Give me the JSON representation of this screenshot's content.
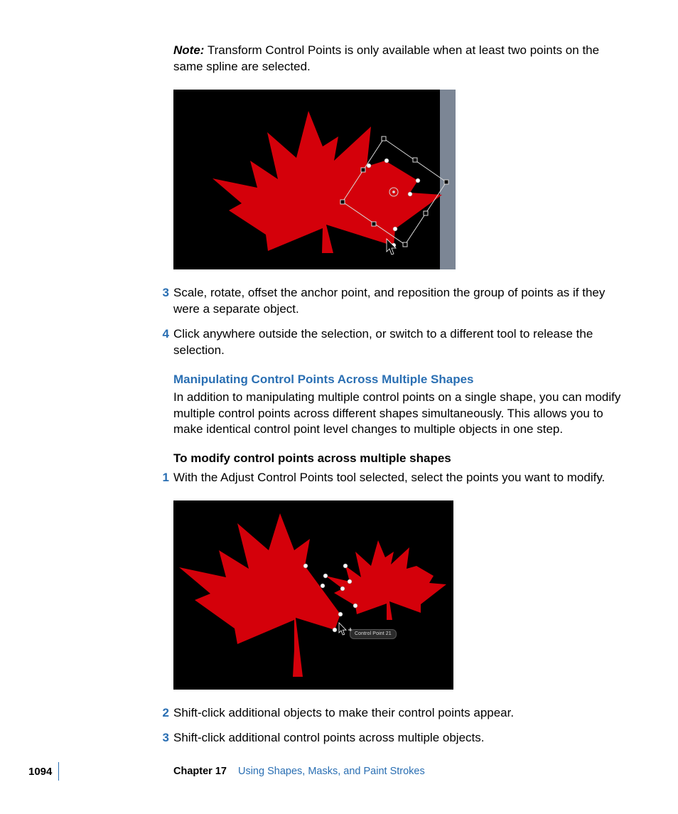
{
  "note": {
    "label": "Note:",
    "text": "  Transform Control Points is only available when at least two points on the same spline are selected."
  },
  "steps_a": {
    "s3": {
      "num": "3",
      "text": "Scale, rotate, offset the anchor point, and reposition the group of points as if they were a separate object."
    },
    "s4": {
      "num": "4",
      "text": "Click anywhere outside the selection, or switch to a different tool to release the selection."
    }
  },
  "section": {
    "heading": "Manipulating Control Points Across Multiple Shapes",
    "body": "In addition to manipulating multiple control points on a single shape, you can modify multiple control points across different shapes simultaneously. This allows you to make identical control point level changes to multiple objects in one step."
  },
  "task": {
    "heading": "To modify control points across multiple shapes",
    "s1": {
      "num": "1",
      "text": "With the Adjust Control Points tool selected, select the points you want to modify."
    },
    "s2": {
      "num": "2",
      "text": "Shift-click additional objects to make their control points appear."
    },
    "s3": {
      "num": "3",
      "text": "Shift-click additional control points across multiple objects."
    }
  },
  "figure2": {
    "tooltip": "Control Point 21"
  },
  "footer": {
    "page": "1094",
    "chapter_label": "Chapter 17",
    "chapter_title": "Using Shapes, Masks, and Paint Strokes"
  }
}
